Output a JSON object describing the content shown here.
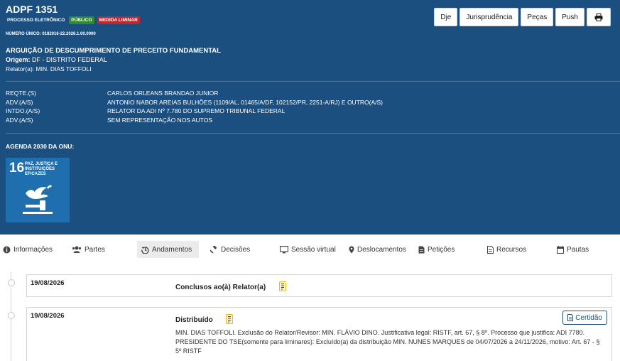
{
  "processo": {
    "titulo": "ADPF 1351",
    "badge_eletronico": "PROCESSO ELETRÔNICO",
    "badge_publico": "PÚBLICO",
    "badge_liminar": "MEDIDA LIMINAR",
    "numero_unico": "NÚMERO ÚNICO: 0182016-22.2026.1.00.0000",
    "classe": "ARGUIÇÃO DE DESCUMPRIMENTO DE PRECEITO FUNDAMENTAL",
    "origem_label": "Origem:",
    "origem_valor": "DF - DISTRITO FEDERAL",
    "relator": "Relator(a): MIN. DIAS TOFFOLI"
  },
  "botoes": {
    "dje": "Dje",
    "jurisprudencia": "Jurisprudência",
    "pecas": "Peças",
    "push": "Push"
  },
  "partes": [
    {
      "tipo": "REQTE.(S)",
      "nome": "CARLOS ORLEANS BRANDAO JUNIOR"
    },
    {
      "tipo": "ADV.(A/S)",
      "nome": "ANTONIO NABOR AREIAS BULHÕES (1109/AL, 01465/A/DF, 102152/PR, 2251-A/RJ) E OUTRO(A/S)"
    },
    {
      "tipo": "INTDO.(A/S)",
      "nome": "RELATOR DA ADI Nº 7.780 DO SUPREMO TRIBUNAL FEDERAL"
    },
    {
      "tipo": "ADV.(A/S)",
      "nome": "SEM REPRESENTAÇÃO NOS AUTOS"
    }
  ],
  "agenda": {
    "label": "AGENDA 2030 DA ONU:",
    "ods_numero": "16",
    "ods_texto": "PAZ, JUSTIÇA E INSTITUIÇÕES EFICAZES"
  },
  "abas": [
    {
      "label": "Informações",
      "icon": "info-icon"
    },
    {
      "label": "Partes",
      "icon": "users-icon"
    },
    {
      "label": "Andamentos",
      "icon": "history-icon"
    },
    {
      "label": "Decisões",
      "icon": "gavel-icon"
    },
    {
      "label": "Sessão virtual",
      "icon": "monitor-icon"
    },
    {
      "label": "Deslocamentos",
      "icon": "map-marker-icon"
    },
    {
      "label": "Petições",
      "icon": "file-pdf-icon"
    },
    {
      "label": "Recursos",
      "icon": "file-text-icon"
    },
    {
      "label": "Pautas",
      "icon": "calendar-icon"
    }
  ],
  "andamentos": [
    {
      "data": "19/08/2026",
      "titulo": "Conclusos ao(à) Relator(a)"
    },
    {
      "data": "19/08/2026",
      "titulo": "Distribuído",
      "botao": "Certidão",
      "descricao": "MIN. DIAS TOFFOLI. Exclusão do Relator/Revisor: MIN. FLÁVIO DINO. Justificativa legal: RISTF, art. 67, § 8º. Processo que justifica: ADI 7780. PRESIDENTE DO TSE(somente para liminares): Excluído(a) da distribuição MIN. NUNES MARQUES de 04/07/2026 a 24/11/2026, motivo: Art. 67 - § 5º RISTF"
    }
  ],
  "cores": {
    "header": "#1a4f7f",
    "ods": "#1f6fae",
    "badge_publico": "#2e8b2e",
    "badge_liminar": "#c0262d",
    "doc_icon": "#e8b923"
  }
}
